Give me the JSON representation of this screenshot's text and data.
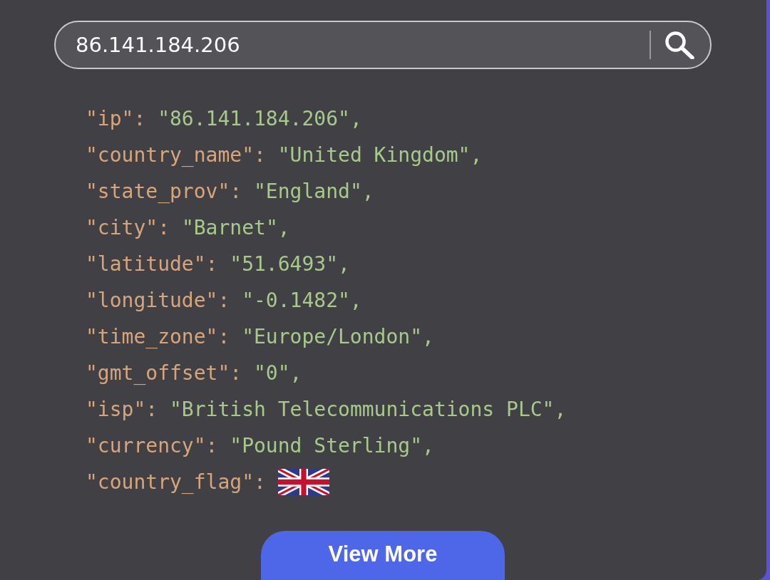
{
  "search": {
    "value": "86.141.184.206"
  },
  "result": {
    "lines": [
      {
        "kind": "text",
        "key": "\"ip\":",
        "value": "\"86.141.184.206\","
      },
      {
        "kind": "text",
        "key": "\"country_name\":",
        "value": "\"United Kingdom\","
      },
      {
        "kind": "text",
        "key": "\"state_prov\":",
        "value": "\"England\","
      },
      {
        "kind": "text",
        "key": "\"city\":",
        "value": "\"Barnet\","
      },
      {
        "kind": "text",
        "key": "\"latitude\":",
        "value": "\"51.6493\","
      },
      {
        "kind": "text",
        "key": "\"longitude\":",
        "value": "\"-0.1482\","
      },
      {
        "kind": "text",
        "key": "\"time_zone\":",
        "value": "\"Europe/London\","
      },
      {
        "kind": "text",
        "key": "\"gmt_offset\":",
        "value": "\"0\","
      },
      {
        "kind": "text",
        "key": "\"isp\":",
        "value": "\"British Telecommunications PLC\","
      },
      {
        "kind": "text",
        "key": "\"currency\":",
        "value": "\"Pound Sterling\","
      },
      {
        "kind": "flag",
        "key": "\"country_flag\":"
      }
    ]
  },
  "button": {
    "label": "View More"
  }
}
